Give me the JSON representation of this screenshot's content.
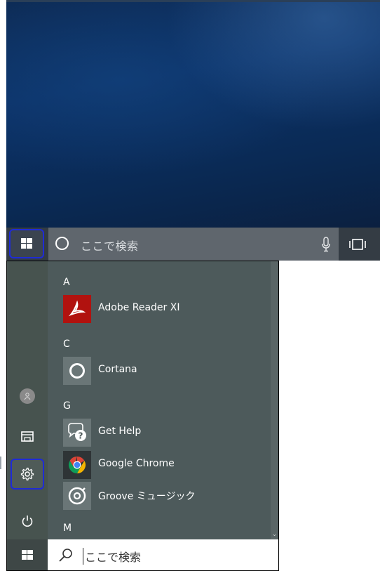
{
  "taskbar": {
    "search_placeholder": "ここで検索",
    "start_icon": "windows-logo-icon",
    "cortana_icon": "cortana-ring-icon",
    "mic_icon": "microphone-icon",
    "taskview_icon": "task-view-icon"
  },
  "start_menu": {
    "rail": {
      "avatar_icon": "user-avatar-icon",
      "documents_icon": "documents-icon",
      "settings_icon": "gear-icon",
      "power_icon": "power-icon"
    },
    "sections": [
      {
        "letter": "A",
        "apps": [
          {
            "name": "Adobe Reader XI",
            "icon": "adobe-reader-icon"
          }
        ]
      },
      {
        "letter": "C",
        "apps": [
          {
            "name": "Cortana",
            "icon": "cortana-icon"
          }
        ]
      },
      {
        "letter": "G",
        "apps": [
          {
            "name": "Get Help",
            "icon": "get-help-icon"
          },
          {
            "name": "Google Chrome",
            "icon": "chrome-icon"
          },
          {
            "name": "Groove ミュージック",
            "icon": "groove-music-icon"
          }
        ]
      },
      {
        "letter": "M",
        "apps": []
      }
    ],
    "search_placeholder": "ここで検索"
  },
  "colors": {
    "highlight_border": "#1f2bd6",
    "menu_bg": "#4d5a5b",
    "taskbar_bg": "#343c44"
  }
}
